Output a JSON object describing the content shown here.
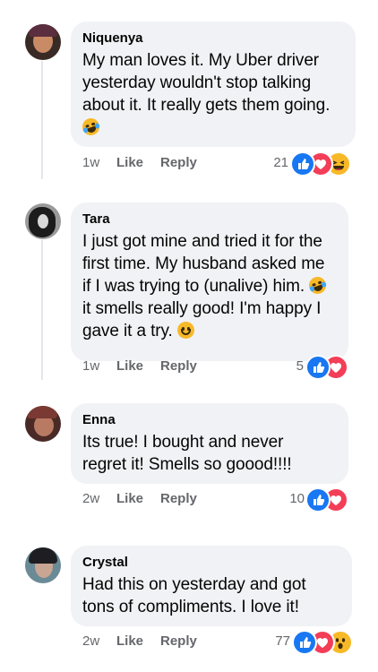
{
  "comments": [
    {
      "author": "Niquenya",
      "text": "My man loves it. My Uber driver yesterday wouldn't stop talking about it. It really gets them going.",
      "time": "1w",
      "like_label": "Like",
      "reply_label": "Reply",
      "reaction_count": "21",
      "reactions": [
        "like-icon",
        "love-icon",
        "haha-icon"
      ]
    },
    {
      "author": "Tara",
      "text_before": "I just got mine and tried it for the first time. My husband asked me if I was trying to (unalive) him.",
      "text_middle": "it smells really good! I'm happy I gave it a try.",
      "time": "1w",
      "like_label": "Like",
      "reply_label": "Reply",
      "reaction_count": "5",
      "reactions": [
        "like-icon",
        "love-icon"
      ]
    },
    {
      "author": "Enna",
      "text": "Its true! I bought and never regret it! Smells so goood!!!!",
      "time": "2w",
      "like_label": "Like",
      "reply_label": "Reply",
      "reaction_count": "10",
      "reactions": [
        "like-icon",
        "love-icon"
      ]
    },
    {
      "author": "Crystal",
      "text": "Had this on yesterday and got tons of compliments. I love it!",
      "time": "2w",
      "like_label": "Like",
      "reply_label": "Reply",
      "reaction_count": "77",
      "reactions": [
        "like-icon",
        "love-icon",
        "wow-icon"
      ]
    }
  ],
  "colors": {
    "bubble": "#f0f2f5",
    "meta_text": "#65676b",
    "like": "#1877f2",
    "love": "#f33e58",
    "emoji_yellow": "#f7b928"
  }
}
